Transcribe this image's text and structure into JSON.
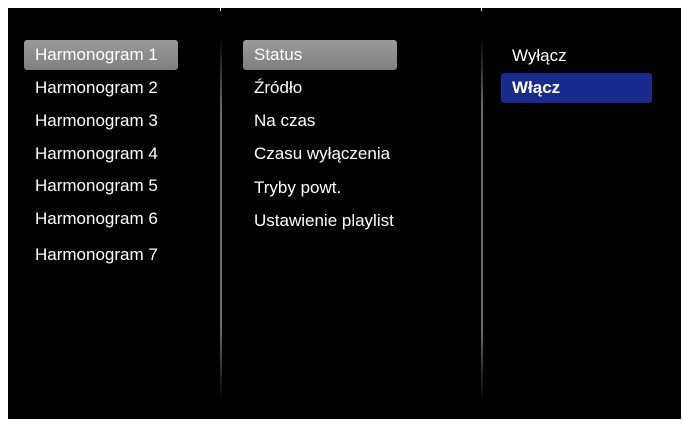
{
  "schedules": {
    "items": [
      {
        "label": "Harmonogram 1",
        "selected": true
      },
      {
        "label": "Harmonogram 2"
      },
      {
        "label": "Harmonogram 3"
      },
      {
        "label": "Harmonogram 4"
      },
      {
        "label": "Harmonogram 5"
      },
      {
        "label": "Harmonogram 6"
      },
      {
        "label": "Harmonogram 7"
      }
    ]
  },
  "settings": {
    "items": [
      {
        "label": "Status",
        "selected": true
      },
      {
        "label": "Źródło"
      },
      {
        "label": "Na czas"
      },
      {
        "label": "Czasu wyłączenia"
      },
      {
        "label": "Tryby powt."
      },
      {
        "label": "Ustawienie playlist"
      }
    ]
  },
  "options": {
    "items": [
      {
        "label": "Wyłącz"
      },
      {
        "label": "Włącz",
        "selected": true
      }
    ]
  },
  "colors": {
    "background": "#000000",
    "selection_grey": "#8c8c8c",
    "selection_blue": "#1a2b8f",
    "text": "#ffffff"
  }
}
